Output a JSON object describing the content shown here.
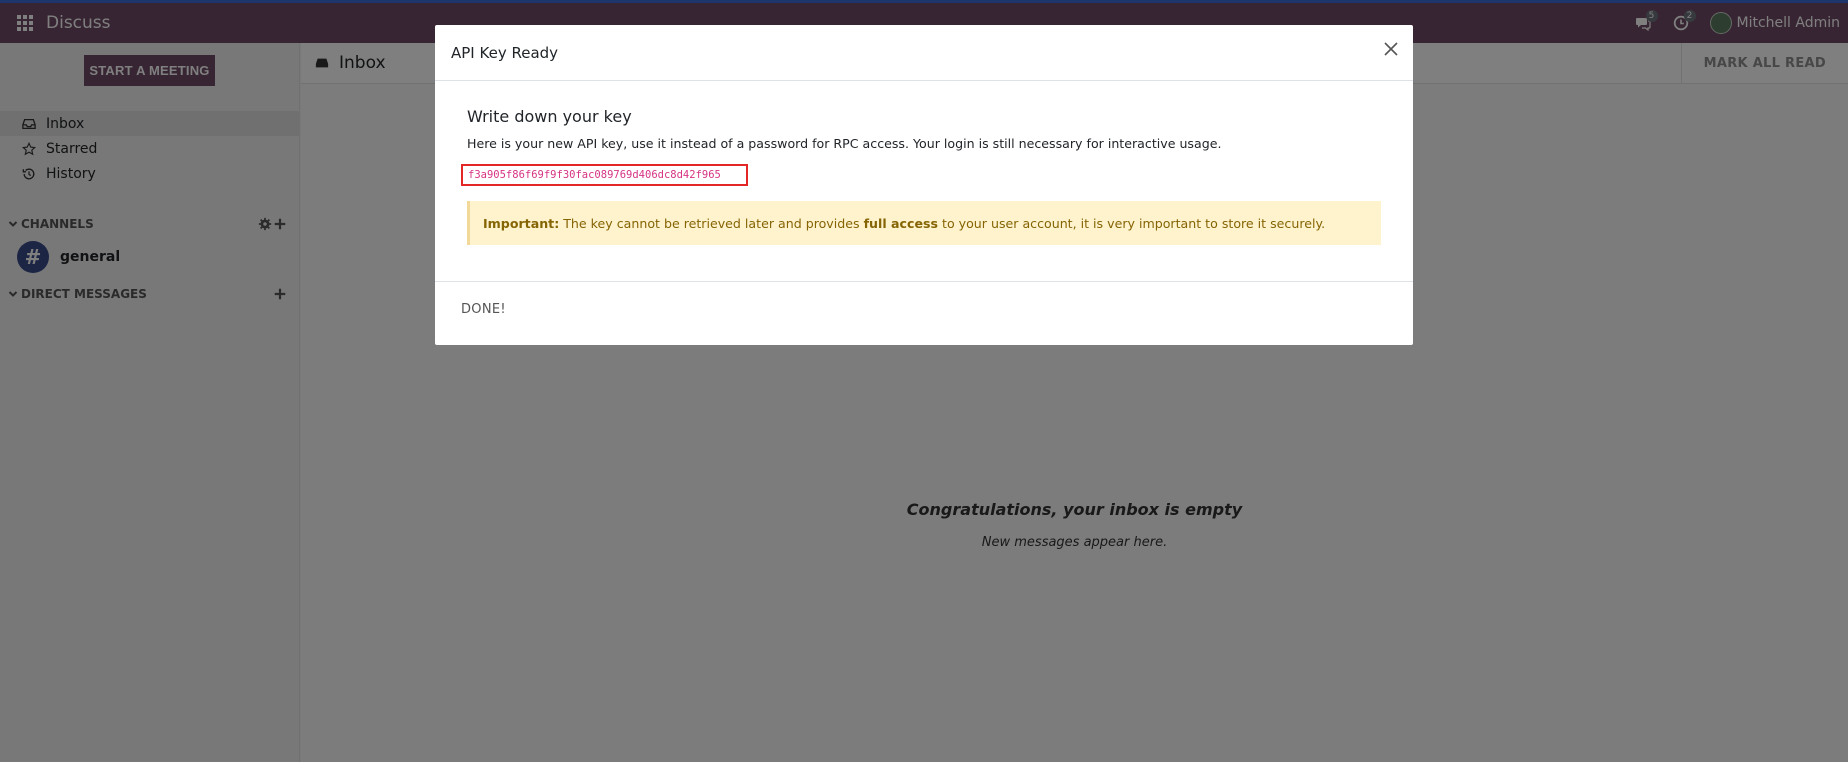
{
  "navbar": {
    "app_name": "Discuss",
    "messages_count": "5",
    "activities_count": "2",
    "user_name": "Mitchell Admin",
    "brand_color": "#714B67"
  },
  "sidebar": {
    "start_meeting": "START A MEETING",
    "mailboxes": [
      {
        "label": "Inbox",
        "icon": "inbox-icon"
      },
      {
        "label": "Starred",
        "icon": "star-icon"
      },
      {
        "label": "History",
        "icon": "history-icon"
      }
    ],
    "channels_header": "CHANNELS",
    "channels": [
      {
        "label": "general",
        "icon": "hashtag-icon"
      }
    ],
    "dm_header": "DIRECT MESSAGES"
  },
  "main": {
    "title": "Inbox",
    "mark_all_read": "MARK ALL READ",
    "empty_title": "Congratulations, your inbox is empty",
    "empty_subtitle": "New messages appear here."
  },
  "modal": {
    "title": "API Key Ready",
    "heading": "Write down your key",
    "description": "Here is your new API key, use it instead of a password for RPC access. Your login is still necessary for interactive usage.",
    "api_key": "f3a905f86f69f9f30fac089769d406dc8d42f965",
    "alert_label": "Important:",
    "alert_text_1": " The key cannot be retrieved later and provides ",
    "alert_bold": "full access",
    "alert_text_2": " to your user account, it is very important to store it securely.",
    "done_label": "DONE!"
  }
}
